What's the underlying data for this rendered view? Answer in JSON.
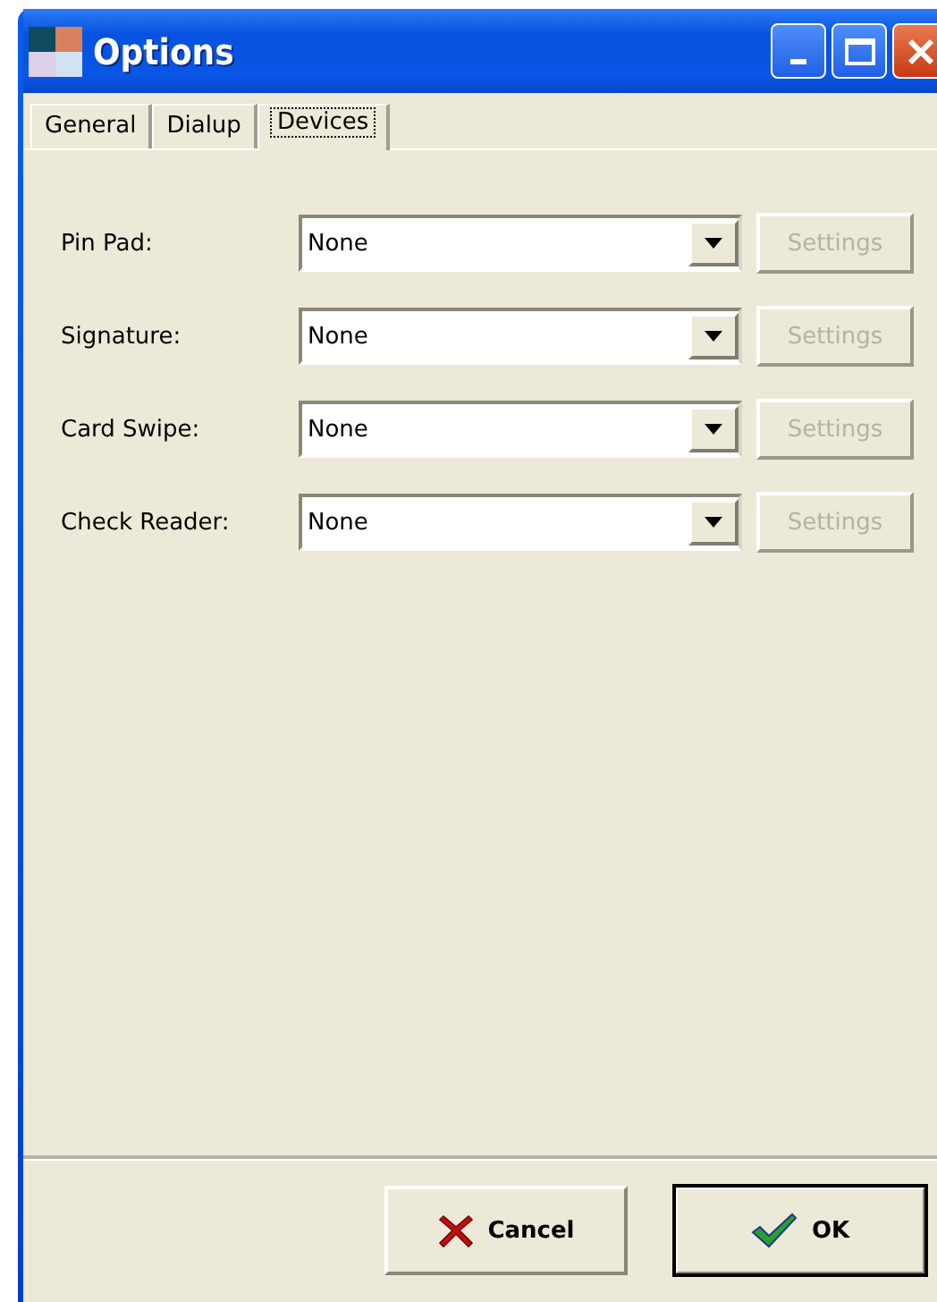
{
  "window": {
    "title": "Options"
  },
  "tabs": [
    {
      "label": "General",
      "selected": false
    },
    {
      "label": "Dialup",
      "selected": false
    },
    {
      "label": "Devices",
      "selected": true
    }
  ],
  "devices": [
    {
      "label": "Pin Pad:",
      "value": "None",
      "settings": {
        "label": "Settings",
        "disabled": true
      }
    },
    {
      "label": "Signature:",
      "value": "None",
      "settings": {
        "label": "Settings",
        "disabled": true
      }
    },
    {
      "label": "Card Swipe:",
      "value": "None",
      "settings": {
        "label": "Settings",
        "disabled": true
      }
    },
    {
      "label": "Check Reader:",
      "value": "None",
      "settings": {
        "label": "Settings",
        "disabled": true
      }
    }
  ],
  "buttons": [
    {
      "kind": "cancel",
      "label": "Cancel",
      "default": false
    },
    {
      "kind": "ok",
      "label": "OK",
      "default": true
    }
  ]
}
